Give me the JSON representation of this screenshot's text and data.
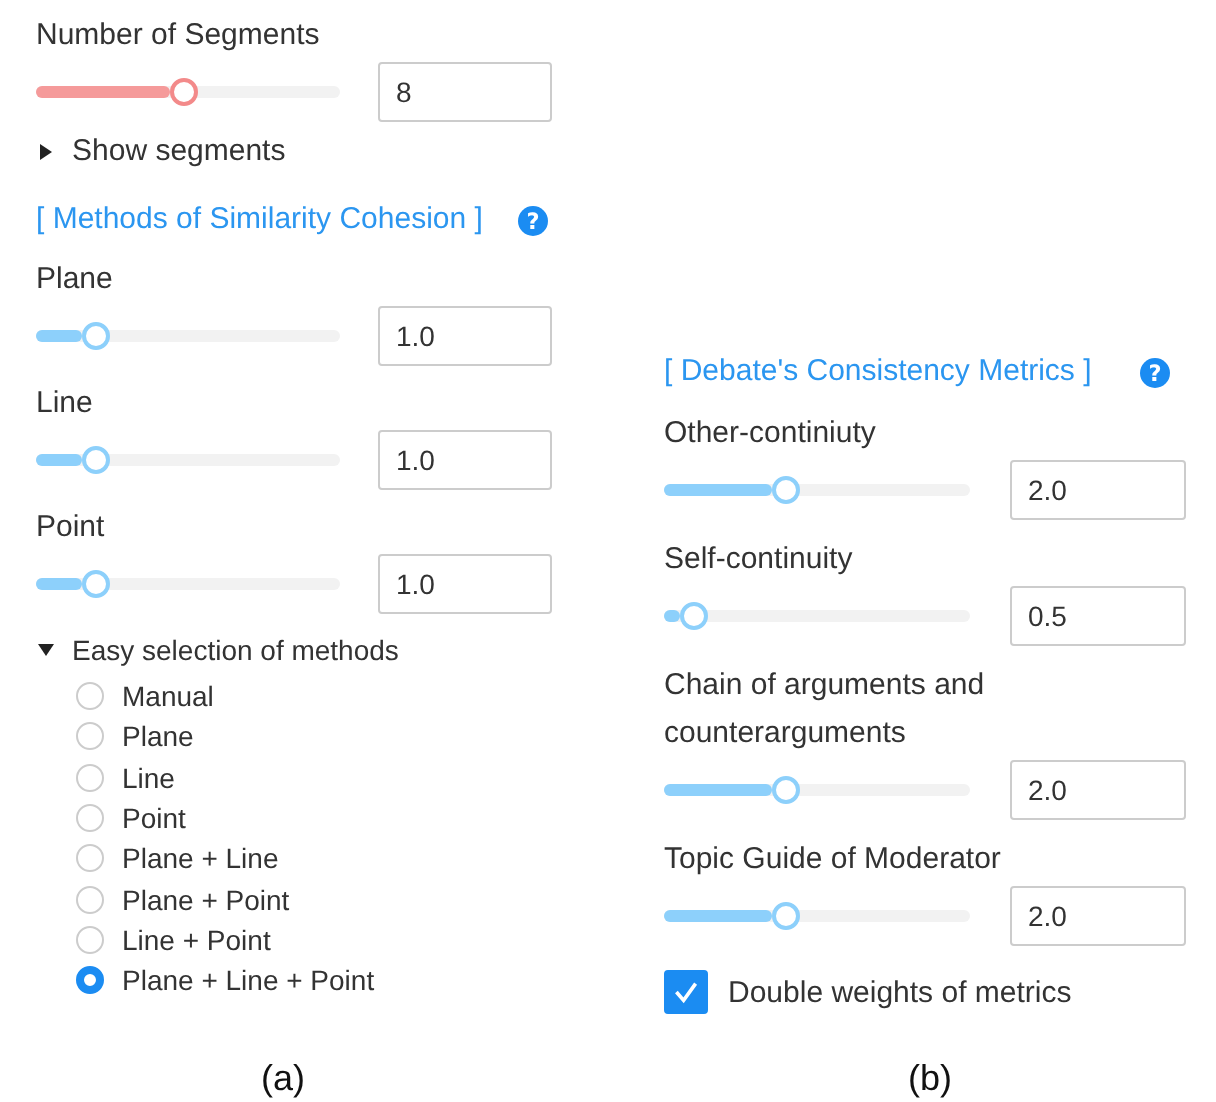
{
  "panel_a": {
    "segments": {
      "label": "Number of Segments",
      "level": 0.49,
      "value": "8"
    },
    "show_segments": {
      "label": "Show segments",
      "expanded": false
    },
    "section_title": "[ Methods of Similarity Cohesion ]",
    "help": "?",
    "weights": [
      {
        "label": "Plane",
        "level": 0.2,
        "value": "1.0"
      },
      {
        "label": "Line",
        "level": 0.2,
        "value": "1.0"
      },
      {
        "label": "Point",
        "level": 0.2,
        "value": "1.0"
      }
    ],
    "easy_selection": {
      "label": "Easy selection of methods",
      "expanded": true,
      "options": [
        {
          "label": "Manual",
          "selected": false
        },
        {
          "label": "Plane",
          "selected": false
        },
        {
          "label": "Line",
          "selected": false
        },
        {
          "label": "Point",
          "selected": false
        },
        {
          "label": "Plane + Line",
          "selected": false
        },
        {
          "label": "Plane + Point",
          "selected": false
        },
        {
          "label": "Line + Point",
          "selected": false
        },
        {
          "label": "Plane + Line + Point",
          "selected": true
        }
      ]
    },
    "caption": "(a)"
  },
  "panel_b": {
    "section_title": "[ Debate's Consistency Metrics ]",
    "help": "?",
    "metrics": [
      {
        "label": "Other-continiuty",
        "level": 0.4,
        "value": "2.0"
      },
      {
        "label": "Self-continuity",
        "level": 0.1,
        "value": "0.5"
      },
      {
        "label": "Chain of arguments and counterarguments",
        "level": 0.4,
        "value": "2.0"
      },
      {
        "label": "Topic Guide of Moderator",
        "level": 0.4,
        "value": "2.0"
      }
    ],
    "double_weights": {
      "label": "Double weights of metrics",
      "checked": true
    },
    "caption": "(b)"
  }
}
